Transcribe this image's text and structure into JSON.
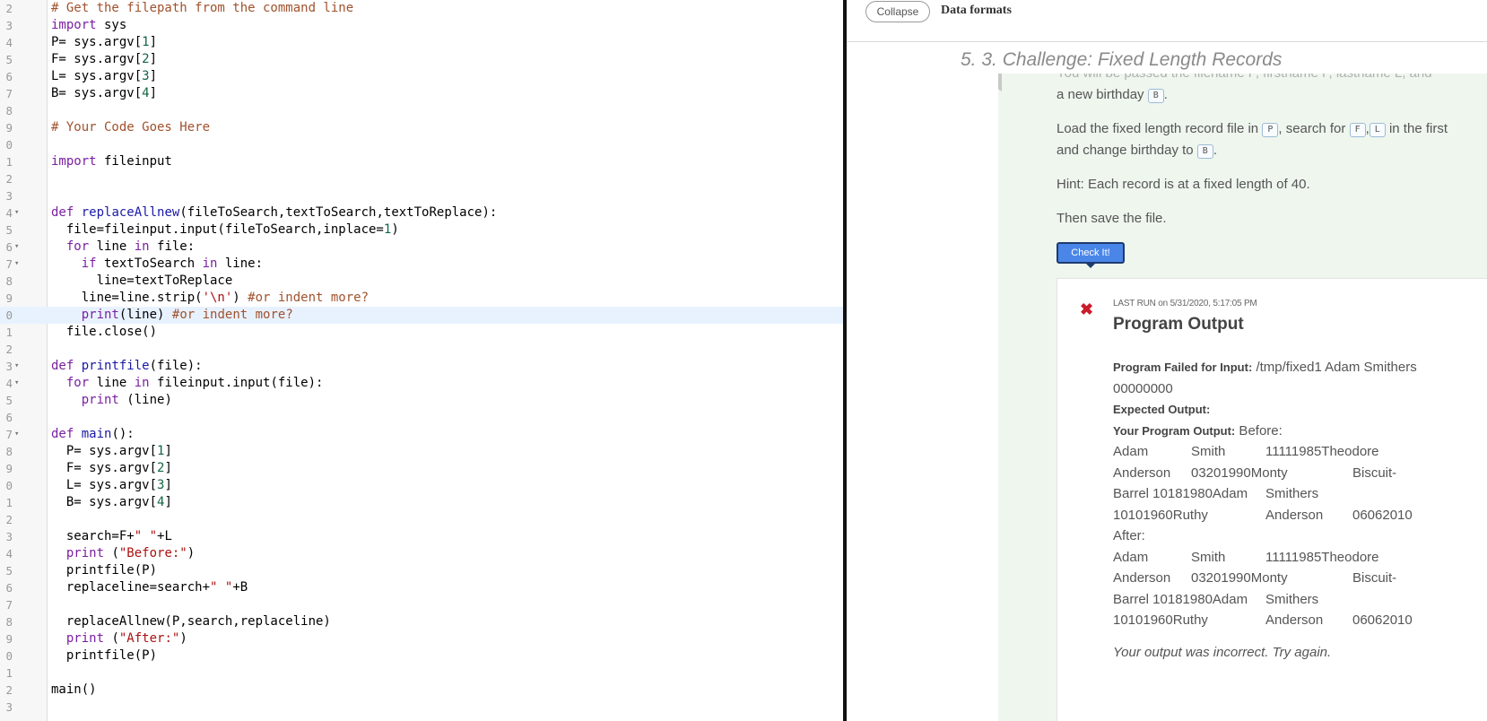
{
  "editor": {
    "lines": [
      {
        "n": "2",
        "fold": false,
        "active": false,
        "tokens": [
          [
            "comment",
            "# Get the filepath from the command line"
          ]
        ]
      },
      {
        "n": "3",
        "fold": false,
        "active": false,
        "tokens": [
          [
            "keyword",
            "import"
          ],
          [
            "plain",
            " sys"
          ]
        ]
      },
      {
        "n": "4",
        "fold": false,
        "active": false,
        "tokens": [
          [
            "plain",
            "P= sys.argv["
          ],
          [
            "num",
            "1"
          ],
          [
            "plain",
            "]"
          ]
        ]
      },
      {
        "n": "5",
        "fold": false,
        "active": false,
        "tokens": [
          [
            "plain",
            "F= sys.argv["
          ],
          [
            "num",
            "2"
          ],
          [
            "plain",
            "]"
          ]
        ]
      },
      {
        "n": "6",
        "fold": false,
        "active": false,
        "tokens": [
          [
            "plain",
            "L= sys.argv["
          ],
          [
            "num",
            "3"
          ],
          [
            "plain",
            "]"
          ]
        ]
      },
      {
        "n": "7",
        "fold": false,
        "active": false,
        "tokens": [
          [
            "plain",
            "B= sys.argv["
          ],
          [
            "num",
            "4"
          ],
          [
            "plain",
            "]"
          ]
        ]
      },
      {
        "n": "8",
        "fold": false,
        "active": false,
        "tokens": []
      },
      {
        "n": "9",
        "fold": false,
        "active": false,
        "tokens": [
          [
            "comment",
            "# Your Code Goes Here"
          ]
        ]
      },
      {
        "n": "0",
        "fold": false,
        "active": false,
        "tokens": []
      },
      {
        "n": "1",
        "fold": false,
        "active": false,
        "tokens": [
          [
            "keyword",
            "import"
          ],
          [
            "plain",
            " fileinput"
          ]
        ]
      },
      {
        "n": "2",
        "fold": false,
        "active": false,
        "tokens": []
      },
      {
        "n": "3",
        "fold": false,
        "active": false,
        "tokens": []
      },
      {
        "n": "4",
        "fold": true,
        "active": false,
        "tokens": [
          [
            "keyword",
            "def"
          ],
          [
            "plain",
            " "
          ],
          [
            "def",
            "replaceAllnew"
          ],
          [
            "plain",
            "(fileToSearch,textToSearch,textToReplace):"
          ]
        ]
      },
      {
        "n": "5",
        "fold": false,
        "active": false,
        "tokens": [
          [
            "plain",
            "  file=fileinput.input(fileToSearch,inplace="
          ],
          [
            "num",
            "1"
          ],
          [
            "plain",
            ")"
          ]
        ]
      },
      {
        "n": "6",
        "fold": true,
        "active": false,
        "tokens": [
          [
            "plain",
            "  "
          ],
          [
            "keyword",
            "for"
          ],
          [
            "plain",
            " line "
          ],
          [
            "keyword",
            "in"
          ],
          [
            "plain",
            " file:"
          ]
        ]
      },
      {
        "n": "7",
        "fold": true,
        "active": false,
        "tokens": [
          [
            "plain",
            "    "
          ],
          [
            "keyword",
            "if"
          ],
          [
            "plain",
            " textToSearch "
          ],
          [
            "keyword",
            "in"
          ],
          [
            "plain",
            " line:"
          ]
        ]
      },
      {
        "n": "8",
        "fold": false,
        "active": false,
        "tokens": [
          [
            "plain",
            "      line=textToReplace"
          ]
        ]
      },
      {
        "n": "9",
        "fold": false,
        "active": false,
        "tokens": [
          [
            "plain",
            "    line=line.strip("
          ],
          [
            "string",
            "'\\n'"
          ],
          [
            "plain",
            ") "
          ],
          [
            "comment",
            "#or indent more?"
          ]
        ]
      },
      {
        "n": "0",
        "fold": false,
        "active": true,
        "tokens": [
          [
            "plain",
            "    "
          ],
          [
            "keyword",
            "print"
          ],
          [
            "plain",
            "(line) "
          ],
          [
            "comment",
            "#or indent more?"
          ]
        ]
      },
      {
        "n": "1",
        "fold": false,
        "active": false,
        "tokens": [
          [
            "plain",
            "  file.close()"
          ]
        ]
      },
      {
        "n": "2",
        "fold": false,
        "active": false,
        "tokens": []
      },
      {
        "n": "3",
        "fold": true,
        "active": false,
        "tokens": [
          [
            "keyword",
            "def"
          ],
          [
            "plain",
            " "
          ],
          [
            "def",
            "printfile"
          ],
          [
            "plain",
            "(file):"
          ]
        ]
      },
      {
        "n": "4",
        "fold": true,
        "active": false,
        "tokens": [
          [
            "plain",
            "  "
          ],
          [
            "keyword",
            "for"
          ],
          [
            "plain",
            " line "
          ],
          [
            "keyword",
            "in"
          ],
          [
            "plain",
            " fileinput.input(file):"
          ]
        ]
      },
      {
        "n": "5",
        "fold": false,
        "active": false,
        "tokens": [
          [
            "plain",
            "    "
          ],
          [
            "keyword",
            "print"
          ],
          [
            "plain",
            " (line)"
          ]
        ]
      },
      {
        "n": "6",
        "fold": false,
        "active": false,
        "tokens": []
      },
      {
        "n": "7",
        "fold": true,
        "active": false,
        "tokens": [
          [
            "keyword",
            "def"
          ],
          [
            "plain",
            " "
          ],
          [
            "def",
            "main"
          ],
          [
            "plain",
            "():"
          ]
        ]
      },
      {
        "n": "8",
        "fold": false,
        "active": false,
        "tokens": [
          [
            "plain",
            "  P= sys.argv["
          ],
          [
            "num",
            "1"
          ],
          [
            "plain",
            "]"
          ]
        ]
      },
      {
        "n": "9",
        "fold": false,
        "active": false,
        "tokens": [
          [
            "plain",
            "  F= sys.argv["
          ],
          [
            "num",
            "2"
          ],
          [
            "plain",
            "]"
          ]
        ]
      },
      {
        "n": "0",
        "fold": false,
        "active": false,
        "tokens": [
          [
            "plain",
            "  L= sys.argv["
          ],
          [
            "num",
            "3"
          ],
          [
            "plain",
            "]"
          ]
        ]
      },
      {
        "n": "1",
        "fold": false,
        "active": false,
        "tokens": [
          [
            "plain",
            "  B= sys.argv["
          ],
          [
            "num",
            "4"
          ],
          [
            "plain",
            "]"
          ]
        ]
      },
      {
        "n": "2",
        "fold": false,
        "active": false,
        "tokens": []
      },
      {
        "n": "3",
        "fold": false,
        "active": false,
        "tokens": [
          [
            "plain",
            "  search=F+"
          ],
          [
            "string",
            "\" \""
          ],
          [
            "plain",
            "+L"
          ]
        ]
      },
      {
        "n": "4",
        "fold": false,
        "active": false,
        "tokens": [
          [
            "plain",
            "  "
          ],
          [
            "keyword",
            "print"
          ],
          [
            "plain",
            " ("
          ],
          [
            "string",
            "\"Before:\""
          ],
          [
            "plain",
            ")"
          ]
        ]
      },
      {
        "n": "5",
        "fold": false,
        "active": false,
        "tokens": [
          [
            "plain",
            "  printfile(P)"
          ]
        ]
      },
      {
        "n": "6",
        "fold": false,
        "active": false,
        "tokens": [
          [
            "plain",
            "  replaceline=search+"
          ],
          [
            "string",
            "\" \""
          ],
          [
            "plain",
            "+B"
          ]
        ]
      },
      {
        "n": "7",
        "fold": false,
        "active": false,
        "tokens": []
      },
      {
        "n": "8",
        "fold": false,
        "active": false,
        "tokens": [
          [
            "plain",
            "  replaceAllnew(P,search,replaceline)"
          ]
        ]
      },
      {
        "n": "9",
        "fold": false,
        "active": false,
        "tokens": [
          [
            "plain",
            "  "
          ],
          [
            "keyword",
            "print"
          ],
          [
            "plain",
            " ("
          ],
          [
            "string",
            "\"After:\""
          ],
          [
            "plain",
            ")"
          ]
        ]
      },
      {
        "n": "0",
        "fold": false,
        "active": false,
        "tokens": [
          [
            "plain",
            "  printfile(P)"
          ]
        ]
      },
      {
        "n": "1",
        "fold": false,
        "active": false,
        "tokens": []
      },
      {
        "n": "2",
        "fold": false,
        "active": false,
        "tokens": [
          [
            "plain",
            "main()"
          ]
        ]
      },
      {
        "n": "3",
        "fold": false,
        "active": false,
        "tokens": []
      }
    ]
  },
  "topbar": {
    "collapse_label": "Collapse",
    "title": "Data formats"
  },
  "section": {
    "title": "5. 3. Challenge: Fixed Length Records"
  },
  "instructions": {
    "cut_off_line": "You will be passed the filename P, firstname F, lastname L, and",
    "line1_text": "a new birthday",
    "line1_var": "B",
    "line2_a": "Load the fixed length record file in",
    "line2_var_p": "P",
    "line2_b": ", search for",
    "line2_var_f": "F",
    "line2_comma": ",",
    "line2_var_l": "L",
    "line2_c": " in the first",
    "line3_text": "and change birthday to",
    "line3_var": "B",
    "hint": "Hint: Each record is at a fixed length of 40.",
    "save": "Then save the file."
  },
  "check_button": {
    "label": "Check It!"
  },
  "result": {
    "status_icon": "x-icon",
    "status_color": "#cc1a2b",
    "last_run_label": "LAST RUN",
    "last_run_on": " on 5/31/2020, 5:17:05 PM",
    "title": "Program Output",
    "failed_label": "Program Failed for Input:",
    "failed_value": " /tmp/fixed1 Adam Smithers",
    "failed_value2": "00000000",
    "expected_label": "Expected Output:",
    "your_output_label": "Your Program Output:",
    "your_output_value": " Before:",
    "before_rows": [
      [
        "Adam",
        "Smith",
        "11111985Theodore",
        ""
      ],
      [
        "Anderson",
        "03201990Monty",
        "",
        "Biscuit-"
      ],
      [
        "Barrel  10181980Adam",
        "",
        "Smithers",
        ""
      ],
      [
        "10101960Ruthy",
        "",
        "Anderson",
        "06062010"
      ]
    ],
    "after_label": "After:",
    "after_rows": [
      [
        "Adam",
        "Smith",
        "11111985Theodore",
        ""
      ],
      [
        "Anderson",
        "03201990Monty",
        "",
        "Biscuit-"
      ],
      [
        "Barrel  10181980Adam",
        "",
        "Smithers",
        ""
      ],
      [
        "10101960Ruthy",
        "",
        "Anderson",
        "06062010"
      ]
    ],
    "incorrect_message": "Your output was incorrect. Try again."
  },
  "colors": {
    "check_button": "#4a86e8",
    "content_bg": "#eef6ee",
    "divider": "#111111"
  }
}
